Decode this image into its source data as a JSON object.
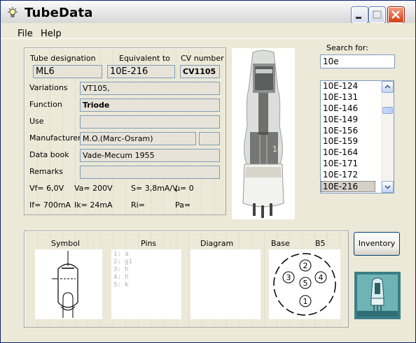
{
  "window": {
    "title": "TubeData",
    "menu": [
      "File",
      "Help"
    ]
  },
  "fields": {
    "tube_designation_label": "Tube designation",
    "tube_designation": "ML6",
    "equivalent_label": "Equivalent to",
    "equivalent": "10E-216",
    "cv_label": "CV number",
    "cv_number": "CV1105",
    "variations_label": "Variations",
    "variations": "VT105,",
    "function_label": "Function",
    "function": "Triode",
    "use_label": "Use",
    "use": "",
    "manufacturer_label": "Manufacturer",
    "manufacturer": "M.O.(Marc-Osram)",
    "manufacturer_extra": "",
    "databook_label": "Data book",
    "databook": "Vade-Mecum 1955",
    "remarks_label": "Remarks",
    "remarks": ""
  },
  "params": {
    "vf": "Vf= 6,0V",
    "va": "Va= 200V",
    "s": "S= 3,8mA/V",
    "mu": "µ= 0",
    "if": "If= 700mA",
    "ik": "Ik= 24mA",
    "ri": "Ri=",
    "pa": "Pa="
  },
  "search": {
    "label": "Search for:",
    "value": "10e"
  },
  "results": {
    "items": [
      "10E-124",
      "10E-131",
      "10E-146",
      "10E-149",
      "10E-156",
      "10E-159",
      "10E-164",
      "10E-171",
      "10E-172",
      "10E-216"
    ],
    "selected": "10E-216"
  },
  "bottom": {
    "symbol_label": "Symbol",
    "pins_label": "Pins",
    "diagram_label": "Diagram",
    "base_label": "Base",
    "base_type": "B5",
    "pins": [
      "1: a",
      "2: g1",
      "3: h",
      "4: h",
      "5: k"
    ],
    "base_pin_numbers": [
      "1",
      "2",
      "3",
      "4",
      "5"
    ]
  },
  "inventory_button": "Inventory",
  "icons": {
    "app": "lightbulb-icon",
    "minimize": "minimize-icon",
    "maximize": "maximize-icon",
    "close": "close-icon"
  },
  "colors": {
    "window_bg": "#ece9d8",
    "selection": "#d4d0c8",
    "close_red": "#d33b12"
  }
}
